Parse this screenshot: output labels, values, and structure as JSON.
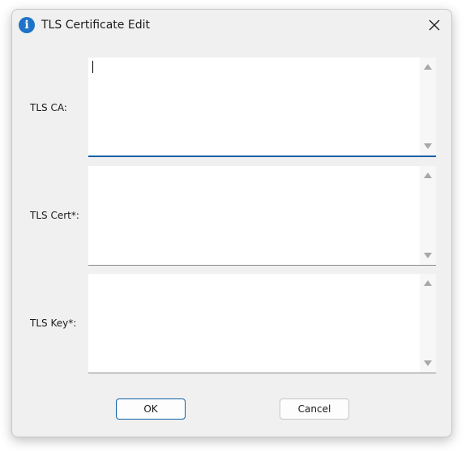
{
  "window": {
    "title": "TLS Certificate Edit",
    "icon": "info-icon",
    "icon_glyph": "i",
    "close_icon": "close-icon"
  },
  "fields": [
    {
      "label": "TLS CA:",
      "value": "",
      "focused": true
    },
    {
      "label": "TLS Cert*:",
      "value": "",
      "focused": false
    },
    {
      "label": "TLS Key*:",
      "value": "",
      "focused": false
    }
  ],
  "buttons": {
    "ok_label": "OK",
    "cancel_label": "Cancel"
  },
  "colors": {
    "accent": "#0f5fa8",
    "info_icon": "#1e73c8"
  }
}
